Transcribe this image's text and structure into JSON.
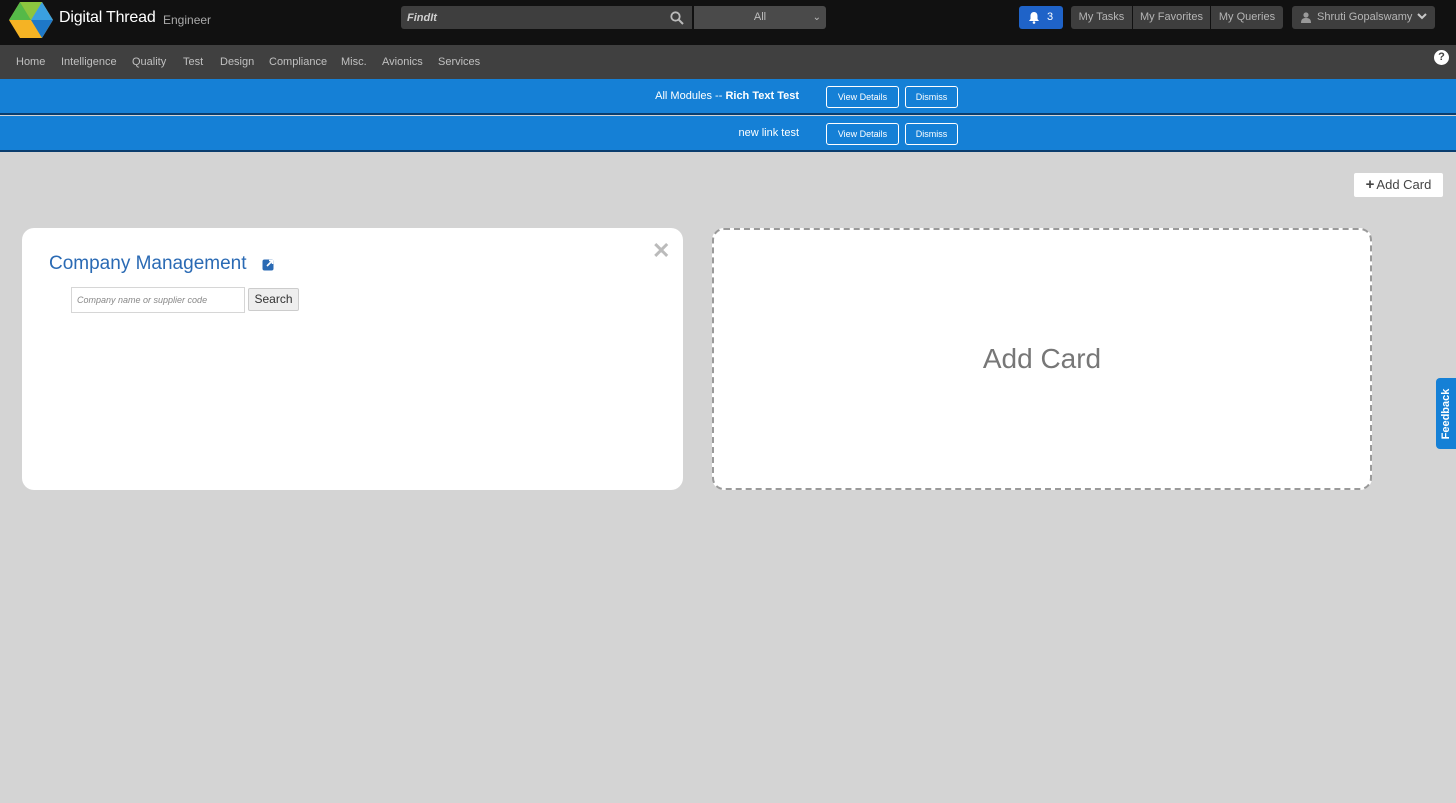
{
  "app": {
    "title": "Digital Thread",
    "subtitle": "Engineer"
  },
  "search": {
    "placeholder": "FindIt",
    "scope": "All"
  },
  "header": {
    "notification_count": "3",
    "my_tasks": "My Tasks",
    "my_favorites": "My Favorites",
    "my_queries": "My Queries",
    "user_name": "Shruti Gopalswamy"
  },
  "nav": {
    "items": [
      "Home",
      "Intelligence",
      "Quality",
      "Test",
      "Design",
      "Compliance",
      "Misc.",
      "Avionics",
      "Services"
    ],
    "help": "?"
  },
  "banners": [
    {
      "prefix": "All Modules -- ",
      "title": "Rich Text Test",
      "view_label": "View Details",
      "dismiss_label": "Dismiss"
    },
    {
      "prefix": "",
      "title": "new link test",
      "view_label": "View Details",
      "dismiss_label": "Dismiss"
    }
  ],
  "toolbar": {
    "add_card": "Add Card"
  },
  "company_card": {
    "title": "Company Management",
    "input_placeholder": "Company name or supplier code",
    "search_label": "Search"
  },
  "add_card_placeholder": {
    "label": "Add Card"
  },
  "feedback": {
    "label": "Feedback"
  },
  "colors": {
    "accent": "#1580d6",
    "link": "#2a6ab4",
    "notification": "#1f63c8"
  }
}
